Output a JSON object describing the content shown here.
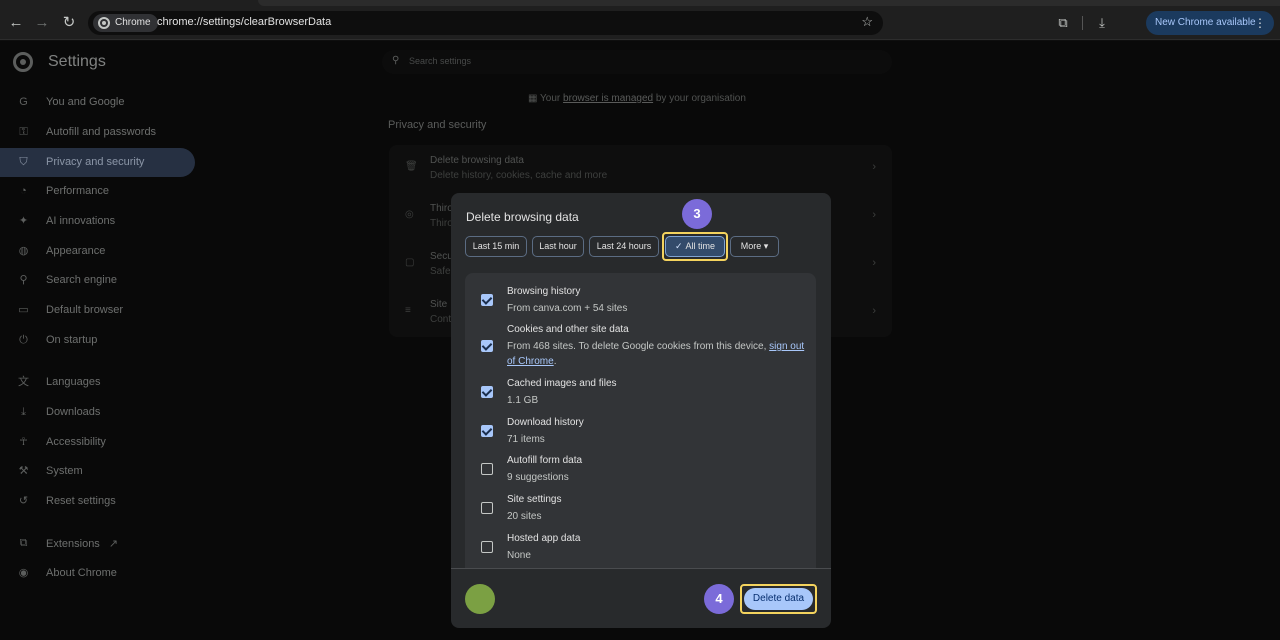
{
  "browser": {
    "chip_label": "Chrome",
    "url": "chrome://settings/clearBrowserData",
    "update_label": "New Chrome available",
    "update_menu": "⋮"
  },
  "app": {
    "title": "Settings",
    "search_placeholder": "Search settings"
  },
  "sidebar": {
    "items": [
      {
        "label": "You and Google",
        "icon": "google-icon"
      },
      {
        "label": "Autofill and passwords",
        "icon": "key-icon"
      },
      {
        "label": "Privacy and security",
        "icon": "shield-icon"
      },
      {
        "label": "Performance",
        "icon": "speedometer-icon"
      },
      {
        "label": "AI innovations",
        "icon": "sparkle-icon"
      },
      {
        "label": "Appearance",
        "icon": "palette-icon"
      },
      {
        "label": "Search engine",
        "icon": "search-icon"
      },
      {
        "label": "Default browser",
        "icon": "browser-icon"
      },
      {
        "label": "On startup",
        "icon": "power-icon"
      },
      {
        "label": "Languages",
        "icon": "translate-icon"
      },
      {
        "label": "Downloads",
        "icon": "download-icon"
      },
      {
        "label": "Accessibility",
        "icon": "accessibility-icon"
      },
      {
        "label": "System",
        "icon": "wrench-icon"
      },
      {
        "label": "Reset settings",
        "icon": "reset-icon"
      },
      {
        "label": "Extensions",
        "icon": "puzzle-icon"
      },
      {
        "label": "About Chrome",
        "icon": "chrome-icon"
      }
    ]
  },
  "managed": {
    "prefix": "Your",
    "link": "browser is managed",
    "suffix": "by your organisation"
  },
  "privacy": {
    "section_title": "Privacy and security",
    "rows": [
      {
        "title": "Delete browsing data",
        "subtitle": "Delete history, cookies, cache and more"
      },
      {
        "title": "Thiro",
        "subtitle": "Thiro"
      },
      {
        "title": "Secu",
        "subtitle": "Safe"
      },
      {
        "title": "Site",
        "subtitle": "Cont"
      }
    ]
  },
  "dialog": {
    "title": "Delete browsing data",
    "ranges": [
      "Last 15 min",
      "Last hour",
      "Last 24 hours",
      "All time",
      "More"
    ],
    "selected_range": "All time",
    "step_badge_range": "3",
    "step_badge_delete": "4",
    "options": [
      {
        "title": "Browsing history",
        "subtitle": "From canva.com + 54 sites",
        "checked": true
      },
      {
        "title": "Cookies and other site data",
        "subtitle": "From 468 sites. To delete Google cookies from this device,",
        "link": "sign out of Chrome",
        "checked": true
      },
      {
        "title": "Cached images and files",
        "subtitle": "1.1 GB",
        "checked": true
      },
      {
        "title": "Download history",
        "subtitle": "71 items",
        "checked": true
      },
      {
        "title": "Autofill form data",
        "subtitle": "9 suggestions",
        "checked": false
      },
      {
        "title": "Site settings",
        "subtitle": "20 sites",
        "checked": false
      },
      {
        "title": "Hosted app data",
        "subtitle": "None",
        "checked": false
      }
    ],
    "delete_label": "Delete data"
  },
  "colors": {
    "accent": "#a8c7fa",
    "callout": "#f4d35e",
    "badge": "#7b6bd9",
    "avatar": "#7ba043"
  }
}
